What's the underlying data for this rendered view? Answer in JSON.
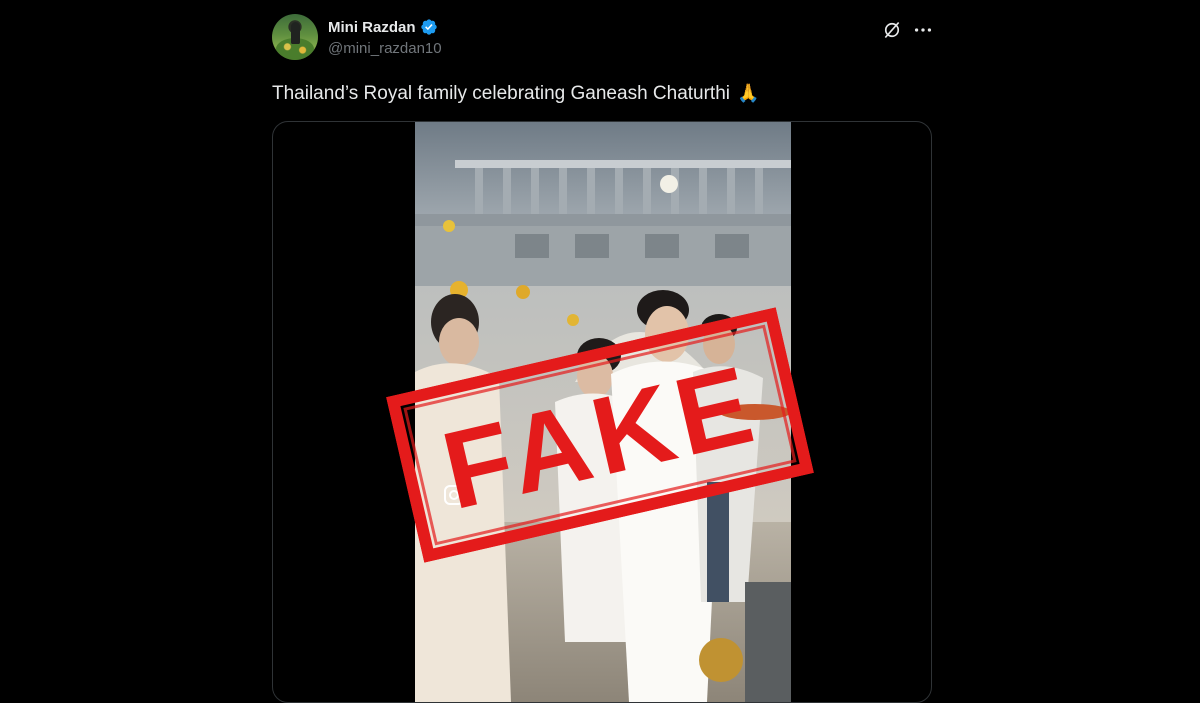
{
  "tweet": {
    "author": {
      "display_name": "Mini Razdan",
      "handle": "@mini_razdan10",
      "verified": true
    },
    "text": "Thailand’s Royal family celebrating Ganeash Chaturthi",
    "emoji": "🙏",
    "icons": {
      "grok": "grok-icon",
      "more": "more-icon",
      "verified": "verified-badge-icon",
      "instagram": "instagram-icon"
    }
  },
  "overlay": {
    "stamp_text": "FAKE",
    "stamp_color": "#e41b1b"
  },
  "colors": {
    "background": "#000000",
    "primary_text": "#e7e9ea",
    "secondary_text": "#71767b",
    "verified_blue": "#1d9bf0",
    "border": "#2f3336"
  }
}
